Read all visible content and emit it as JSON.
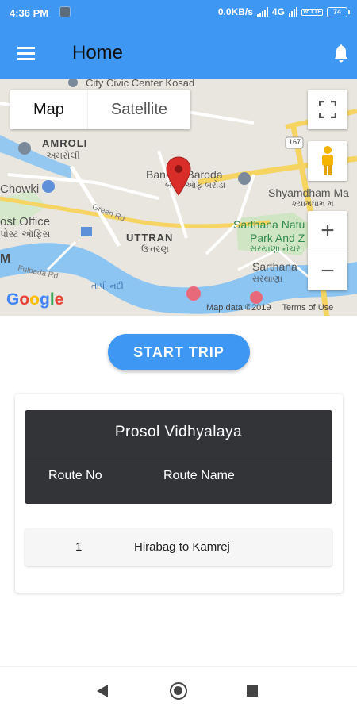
{
  "status_bar": {
    "time": "4:36 PM",
    "network_speed": "0.0KB/s",
    "network_type": "4G",
    "volte": "Vo LTE",
    "battery": "74"
  },
  "app_bar": {
    "title": "Home",
    "menu_icon": "hamburger-menu-icon",
    "notification_icon": "bell-icon"
  },
  "map": {
    "type_options": [
      "Map",
      "Satellite"
    ],
    "selected_type": "Map",
    "labels": {
      "civic_center": "City Civic Center Kosad",
      "amroli": "AMROLI",
      "amroli_gu": "અમરોલી",
      "chowki": "Chowki",
      "bank": "Bank of Baroda",
      "bank_gu": "બૅન્ક ઑફ બરોડા",
      "shyamdham": "Shyamdham Ma",
      "shyamdham_gu": "શ્યામધામ મ",
      "green_rd": "Green Rd",
      "post_office": "ost Office",
      "post_office_gu": "પોસ્ટ ઑફિસ",
      "uttran": "UTTRAN",
      "uttran_gu": "ઉત્તરણ",
      "sarthana_nature": "Sarthana Natu",
      "park": "Park And Z",
      "park_gu": "સરથાણા નેચર",
      "sarthana": "Sarthana",
      "sarthana_gu": "સરથાણા",
      "tapi": "તાપી નદી",
      "m": "M",
      "fulpada": "Fulpada Rd",
      "highway": "167"
    },
    "google_logo": "Google",
    "map_data": "Map data ©2019",
    "terms": "Terms of Use",
    "zoom_in": "+",
    "zoom_out": "−"
  },
  "start_trip_label": "START TRIP",
  "school": {
    "name": "Prosol Vidhyalaya",
    "columns": [
      "Route No",
      "Route Name"
    ],
    "routes": [
      {
        "no": "1",
        "name": "Hirabag to Kamrej"
      }
    ]
  },
  "colors": {
    "primary": "#3e97f3",
    "table_header": "#333437",
    "marker": "#d92d2a"
  }
}
